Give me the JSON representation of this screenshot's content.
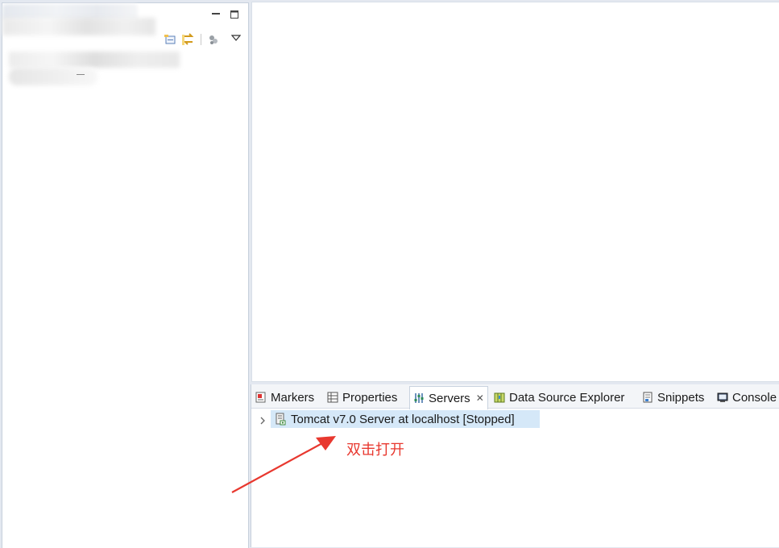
{
  "left_view": {
    "blurred_title": "",
    "toolbar_icons": [
      "minimize-icon",
      "maximize-icon",
      "collapse-all-icon",
      "link-with-editor-icon",
      "filter-icon",
      "view-menu-icon"
    ]
  },
  "bottom_panel": {
    "tabs": [
      {
        "label": "Markers",
        "icon": "markers-icon"
      },
      {
        "label": "Properties",
        "icon": "properties-icon"
      },
      {
        "label": "Servers",
        "icon": "servers-icon",
        "active": true
      },
      {
        "label": "Data Source Explorer",
        "icon": "database-icon"
      },
      {
        "label": "Snippets",
        "icon": "snippets-icon"
      },
      {
        "label": "Console",
        "icon": "console-icon"
      }
    ],
    "server": {
      "name": "Tomcat v7.0 Server at localhost",
      "status": "[Stopped]"
    }
  },
  "annotation": {
    "text": "双击打开",
    "color": "#e8382f"
  },
  "colors": {
    "selection": "#d5e8f8",
    "background": "#e3e8f0"
  }
}
